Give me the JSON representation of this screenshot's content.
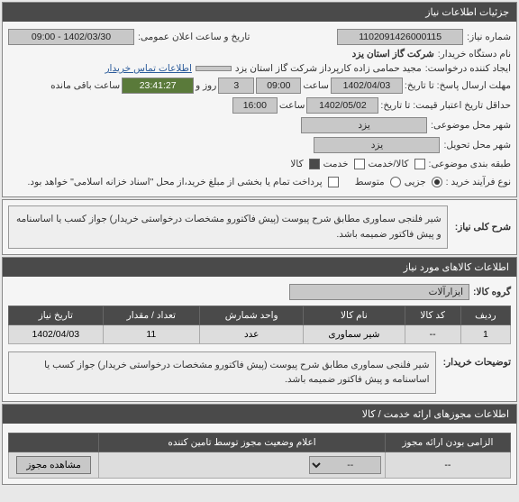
{
  "panel1": {
    "title": "جزئیات اطلاعات نیاز",
    "need_no_label": "شماره نیاز:",
    "need_no": "1102091426000115",
    "pub_datetime_label": "تاریخ و ساعت اعلان عمومی:",
    "pub_datetime": "1402/03/30 - 09:00",
    "buyer_org_label": "نام دستگاه خریدار:",
    "buyer_org": "شرکت گاز استان یزد",
    "requester_label": "ایجاد کننده درخواست:",
    "requester": "مجید حمامی زاده کارپرداز شرکت گاز استان یزد",
    "contact_link": "اطلاعات تماس خریدار",
    "deadline_label": "مهلت ارسال پاسخ: تا تاریخ:",
    "deadline_date": "1402/04/03",
    "deadline_time_label": "ساعت",
    "deadline_time": "09:00",
    "days_label": "روز و",
    "days": "3",
    "remain_label": "ساعت باقی مانده",
    "remain": "23:41:27",
    "validity_label": "حداقل تاریخ اعتبار قیمت: تا تاریخ:",
    "validity_date": "1402/05/02",
    "validity_time_label": "ساعت",
    "validity_time": "16:00",
    "subject_city_label": "شهر محل موضوعی:",
    "subject_city": "یزد",
    "delivery_city_label": "شهر محل تحویل:",
    "delivery_city": "یزد",
    "class_label": "طبقه بندی موضوعی:",
    "class1": "کالا/خدمت",
    "class2": "خدمت",
    "class3": "کالا",
    "process_label": "نوع فرآیند خرید :",
    "radio1": "جزیی",
    "radio2": "متوسط",
    "note": "پرداخت تمام یا بخشی از مبلغ خرید،از محل \"اسناد خزانه اسلامی\" خواهد بود."
  },
  "panel2": {
    "label": "شرح کلی نیاز:",
    "text": "شیر فلنجی سماوری  مطابق شرح پیوست (پیش فاکتورو مشخصات درخواستی خریدار) جواز کسب یا اساسنامه و پیش فاکتور ضمیمه باشد."
  },
  "panel3": {
    "title": "اطلاعات کالاهای مورد نیاز",
    "group_label": "گروه کالا:",
    "group_value": "ایزارآلات",
    "headers": {
      "row": "ردیف",
      "code": "کد کالا",
      "name": "نام کالا",
      "unit": "واحد شمارش",
      "qty": "تعداد / مقدار",
      "date": "تاریخ نیاز"
    },
    "rows": [
      {
        "row": "1",
        "code": "--",
        "name": "شیر سماوری",
        "unit": "عدد",
        "qty": "11",
        "date": "1402/04/03"
      }
    ],
    "buyer_notes_label": "توضیحات خریدار:",
    "buyer_notes": "شیر فلنجی سماوری  مطابق شرح پیوست (پیش فاکتورو مشخصات درخواستی خریدار) جواز کسب یا اساسنامه و پیش فاکتور ضمیمه باشد."
  },
  "panel4": {
    "title": "اطلاعات مجوزهای ارائه خدمت / کالا",
    "headers": {
      "required": "الزامی بودن ارائه مجوز",
      "status": "اعلام وضعیت مجوز توسط تامین کننده"
    },
    "row": {
      "required": "--",
      "status": "--",
      "btn": "مشاهده مجوز"
    }
  }
}
